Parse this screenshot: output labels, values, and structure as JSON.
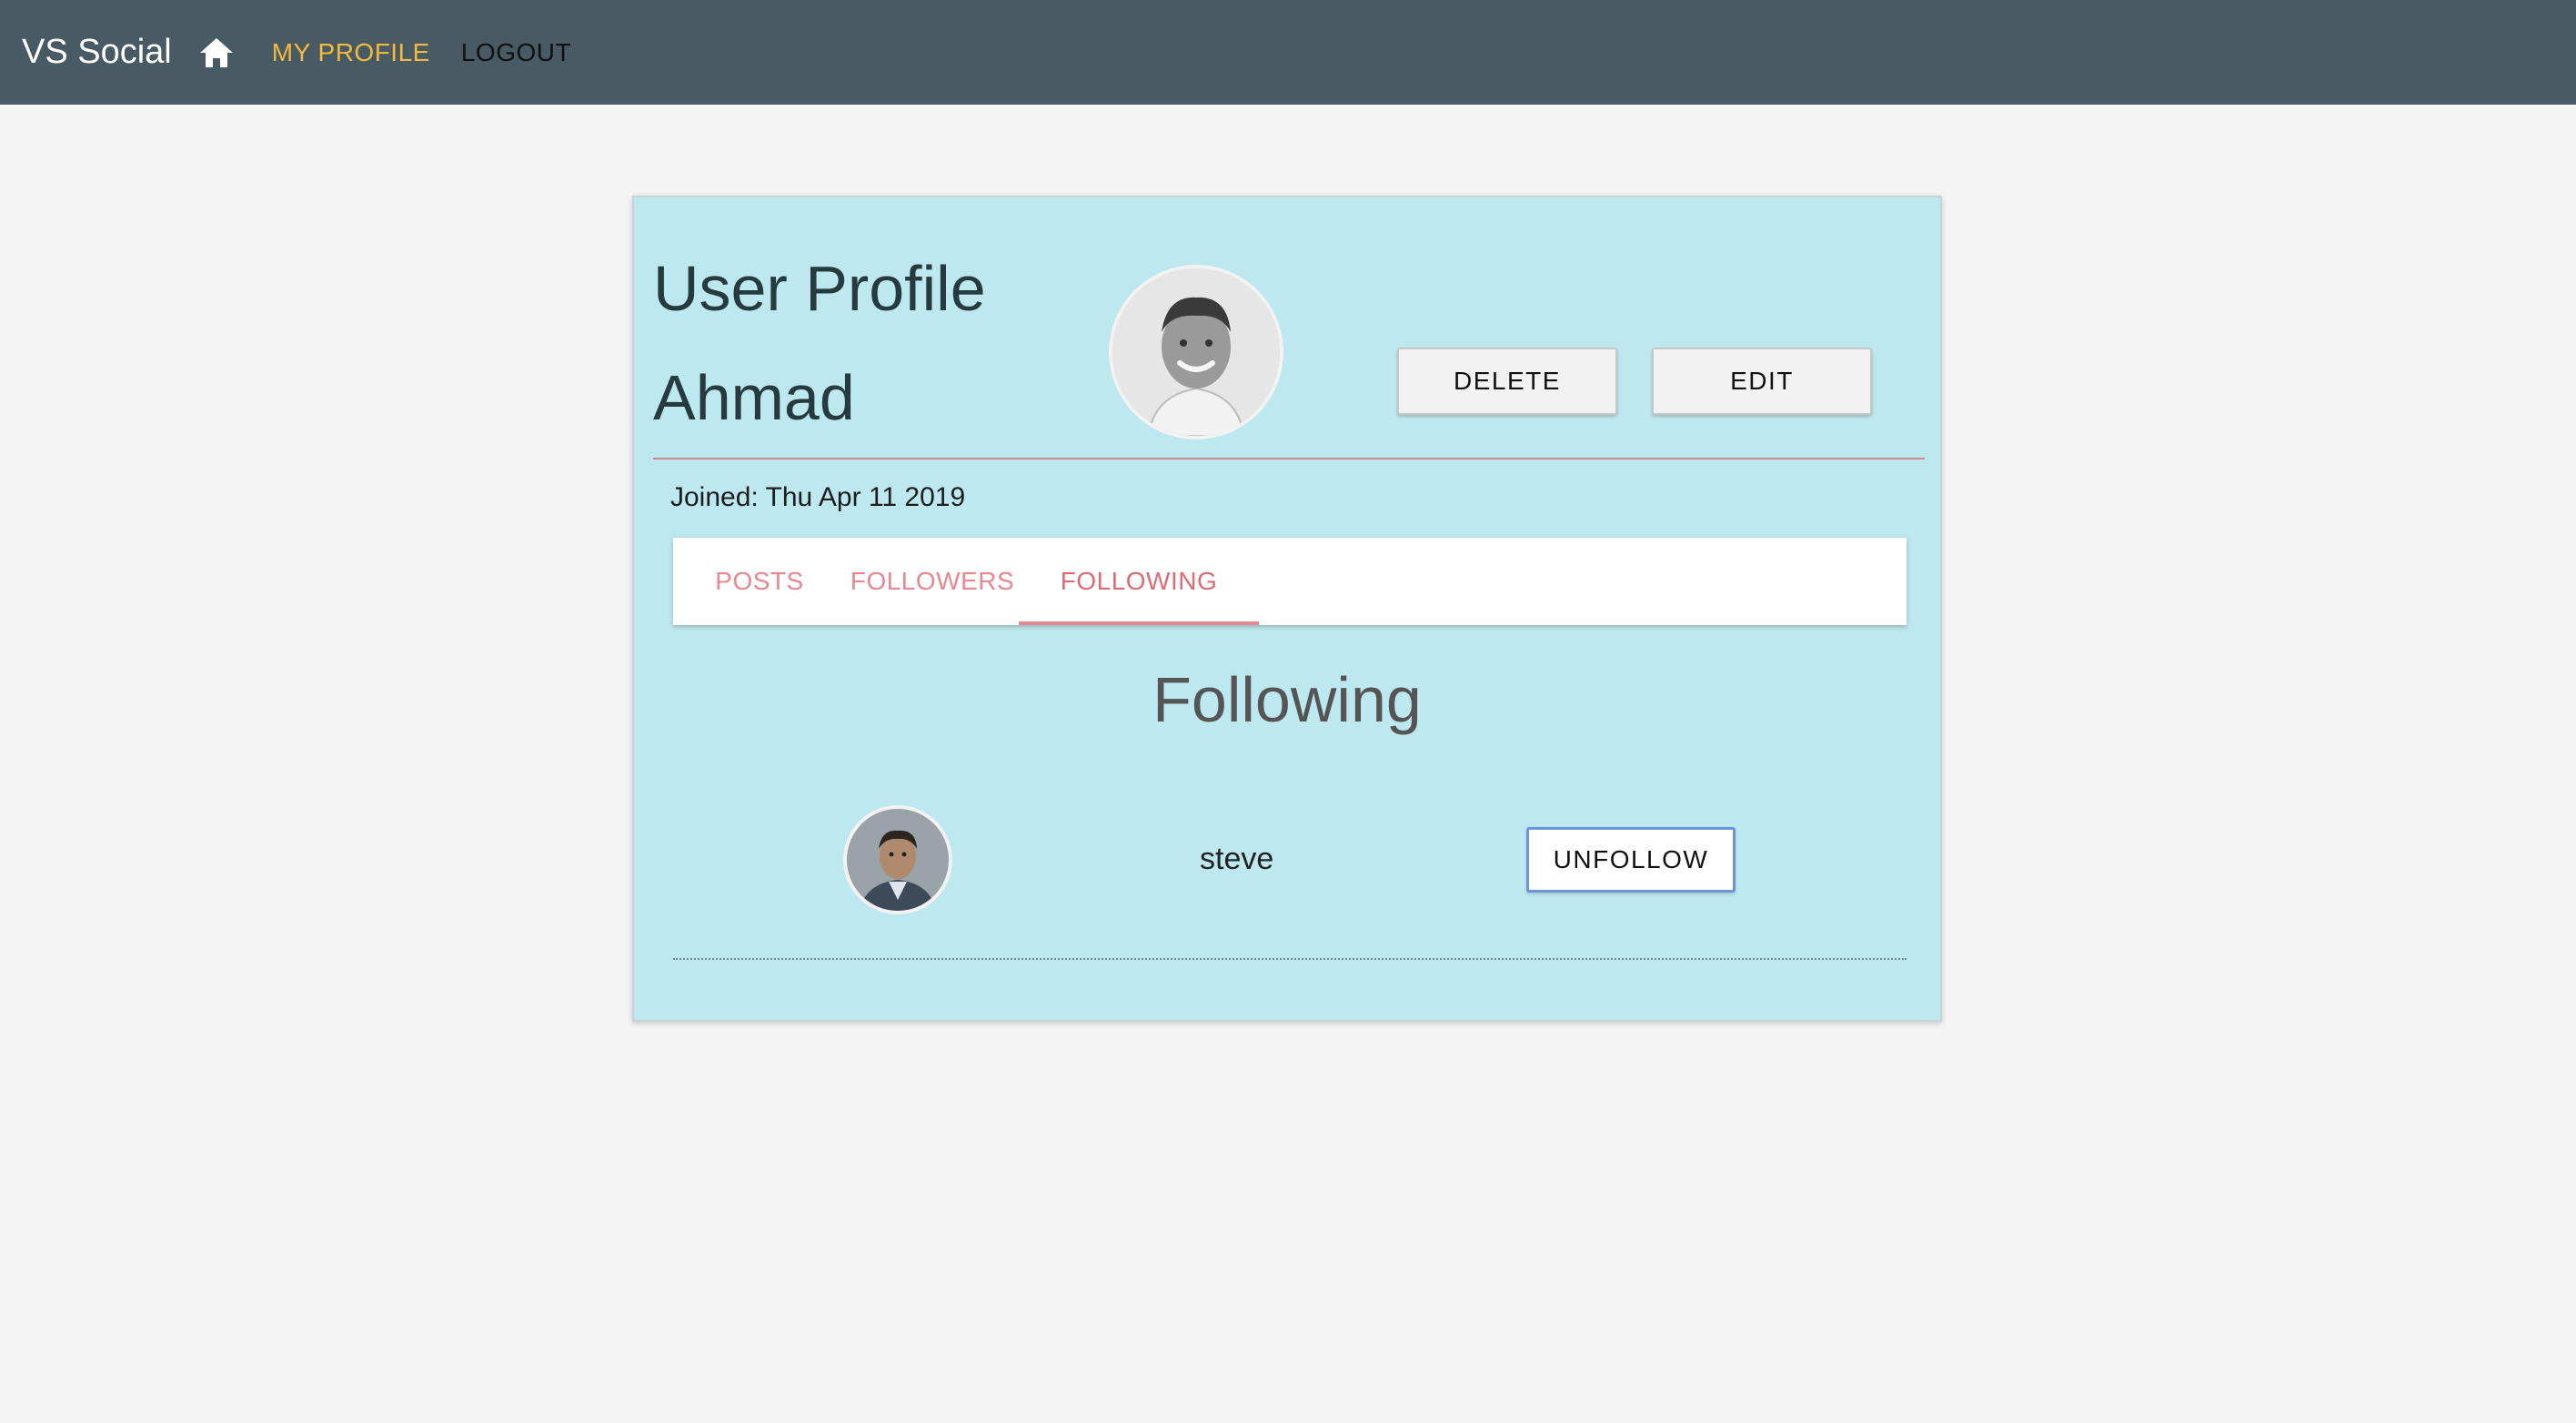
{
  "appbar": {
    "brand": "VS Social",
    "home_icon": "home-icon",
    "nav": [
      {
        "label": "MY PROFILE",
        "active": true
      },
      {
        "label": "LOGOUT",
        "active": false
      }
    ],
    "background": "#485a63",
    "active_color": "#f4b942"
  },
  "profile": {
    "title": "User Profile",
    "name": "Ahmad",
    "avatar_icon": "user-photo",
    "joined": "Joined: Thu Apr 11 2019",
    "actions": {
      "delete_label": "DELETE",
      "edit_label": "EDIT"
    },
    "card_background": "#bde8ef"
  },
  "tabs": [
    {
      "label": "POSTS",
      "active": false
    },
    {
      "label": "FOLLOWERS",
      "active": false
    },
    {
      "label": "FOLLOWING",
      "active": true
    }
  ],
  "following": {
    "heading": "Following",
    "items": [
      {
        "name": "steve",
        "avatar_icon": "user-photo",
        "action_label": "UNFOLLOW"
      }
    ]
  }
}
